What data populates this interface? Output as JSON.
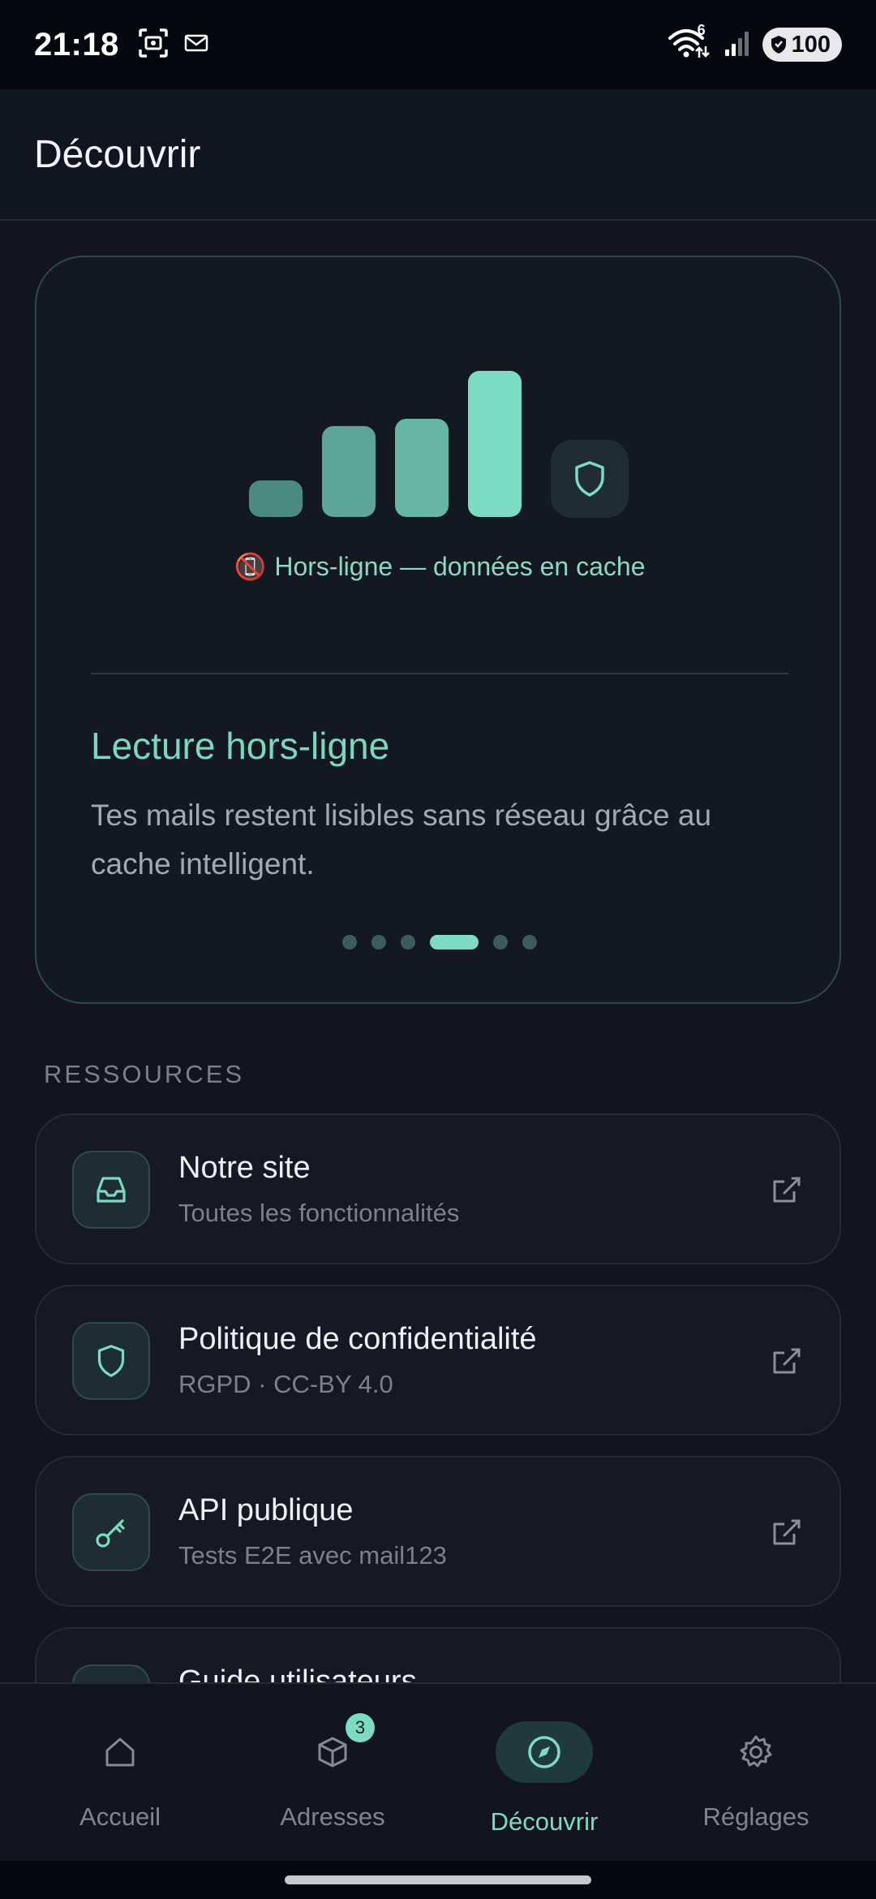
{
  "status_bar": {
    "time": "21:18",
    "wifi_badge": "6",
    "battery": "100",
    "icons": [
      "screenshot-icon",
      "mail-icon",
      "wifi-icon",
      "signal-icon",
      "battery-shield-icon"
    ]
  },
  "header": {
    "title": "Découvrir"
  },
  "feature_card": {
    "illustration_bars": [
      0.25,
      0.62,
      0.67,
      1.0
    ],
    "offline_emoji": "📵",
    "offline_text": "Hors-ligne — données en cache",
    "title": "Lecture hors-ligne",
    "description": "Tes mails restent lisibles sans réseau grâce au cache intelligent.",
    "pager": {
      "count": 6,
      "active_index": 3
    }
  },
  "resources": {
    "section_label": "RESSOURCES",
    "items": [
      {
        "title": "Notre site",
        "subtitle": "Toutes les fonctionnalités",
        "icon": "inbox-icon"
      },
      {
        "title": "Politique de confidentialité",
        "subtitle": "RGPD · CC-BY 4.0",
        "icon": "shield-icon"
      },
      {
        "title": "API publique",
        "subtitle": "Tests E2E avec mail123",
        "icon": "key-icon"
      },
      {
        "title": "Guide utilisateurs",
        "subtitle": "",
        "icon": "book-icon"
      }
    ]
  },
  "bottom_nav": {
    "items": [
      {
        "label": "Accueil",
        "icon": "home-icon"
      },
      {
        "label": "Adresses",
        "icon": "box-icon",
        "badge": "3"
      },
      {
        "label": "Découvrir",
        "icon": "compass-icon",
        "active": true
      },
      {
        "label": "Réglages",
        "icon": "gear-icon"
      }
    ]
  },
  "colors": {
    "accent": "#7bdcc3",
    "background": "#13151e",
    "card_border": "#2c4a4c"
  }
}
